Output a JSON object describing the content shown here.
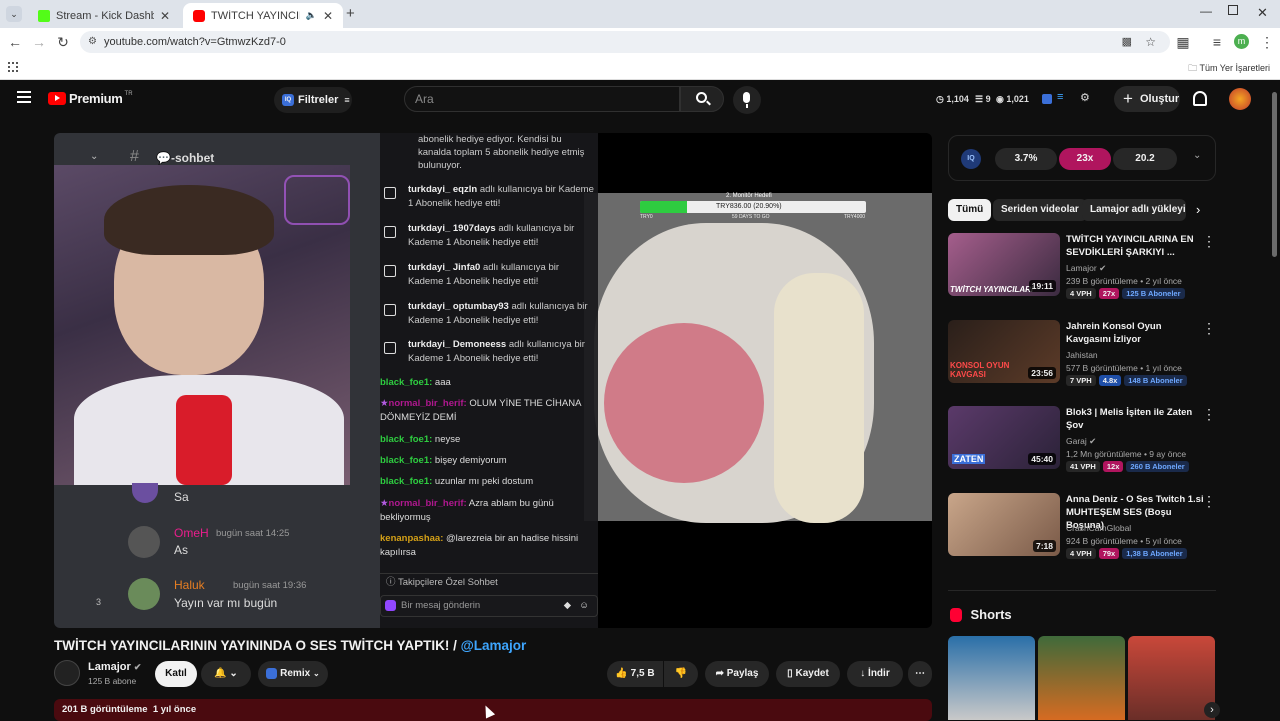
{
  "browser": {
    "tabs": [
      {
        "title": "Stream - Kick Dashboard",
        "active": false,
        "fav_color": "#53fc18"
      },
      {
        "title": "TWİTCH YAYINCILARININ YAYINI...",
        "active": true,
        "fav_color": "#ff0000"
      }
    ],
    "new_tab": "+",
    "url": "youtube.com/watch?v=GtmwzKzd7-0",
    "bookmarks_label": "Tüm Yer İşaretleri",
    "profile_initial": "m"
  },
  "youtube": {
    "logo": "Premium",
    "logo_sup": "TR",
    "filters_label": "Filtreler",
    "search_placeholder": "Ara",
    "stats": [
      "1,104",
      "9",
      "1,021"
    ],
    "create_label": "Oluştur"
  },
  "video": {
    "discord": {
      "channel": "-sohbet",
      "msg1_text": "Sa",
      "msg2_user": "OmeH",
      "msg2_time": "bugün saat 14:25",
      "msg2_text": "As",
      "msg3_user": "Haluk",
      "msg3_time": "bugün saat 19:36",
      "msg3_text": "Yayın var mı bugün",
      "side_number": "3"
    },
    "chat": {
      "intro": "abonelik hediye ediyor. Kendisi bu kanalda toplam 5 abonelik hediye etmiş bulunuyor.",
      "subs": [
        {
          "user": "turkdayi_ eqzln",
          "text": "adlı kullanıcıya bir Kademe 1 Abonelik hediye etti!"
        },
        {
          "user": "turkdayi_ 1907days",
          "text": "adlı kullanıcıya bir Kademe 1 Abonelik hediye etti!"
        },
        {
          "user": "turkdayi_ Jinfa0",
          "text": "adlı kullanıcıya bir Kademe 1 Abonelik hediye etti!"
        },
        {
          "user": "turkdayi_ optumbay93",
          "text": "adlı kullanıcıya bir Kademe 1 Abonelik hediye etti!"
        },
        {
          "user": "turkdayi_ Demoneess",
          "text": "adlı kullanıcıya bir Kademe 1 Abonelik hediye etti!"
        }
      ],
      "lines": [
        {
          "user": "black_foe1:",
          "text": "aaa",
          "color": "#2ecc40"
        },
        {
          "user": "normal_bir_herif:",
          "text": "OLUM YİNE THE CİHANA DÖNMEYİZ DEMİ",
          "color": "#b0188f"
        },
        {
          "user": "black_foe1:",
          "text": "neyse",
          "color": "#2ecc40"
        },
        {
          "user": "black_foe1:",
          "text": "bişey demiyorum",
          "color": "#2ecc40"
        },
        {
          "user": "black_foe1:",
          "text": "uzunlar mı peki dostum",
          "color": "#2ecc40"
        },
        {
          "user": "normal_bir_herif:",
          "text": "Azra ablam bu günü bekliyormuş",
          "color": "#b0188f"
        },
        {
          "user": "kenanpashaa:",
          "text": "@larezreia bir an hadise hissini kapılırsa",
          "color": "#d4a017"
        }
      ],
      "followers_only": "Takipçilere Özel Sohbet",
      "send_placeholder": "Bir mesaj gönderin"
    },
    "goal": {
      "title": "2. Monitör Hedefi",
      "amount": "TRY836.00 (20.90%)",
      "progress": 0.209,
      "left": "TRY0",
      "days": "59 DAYS TO GO",
      "right": "TRY4000"
    }
  },
  "iq": {
    "values": [
      "3.7%",
      "23x",
      "20.2"
    ]
  },
  "chips": [
    "Tümü",
    "Seriden videolar",
    "Lamajor adlı yükleyic"
  ],
  "recommendations": [
    {
      "title": "TWİTCH YAYINCILARINA EN SEVDİKLERİ ŞARKIYI ...",
      "channel": "Lamajor",
      "verified": true,
      "meta": "239 B görüntüleme • 2 yıl önce",
      "vph": "4 VPH",
      "mult": "27x",
      "subs": "125 B Aboneler",
      "duration": "19:11",
      "thumb_text": "TWİTCH YAYINCILARI"
    },
    {
      "title": "Jahrein Konsol Oyun Kavgasını İzliyor",
      "channel": "Jahistan",
      "verified": false,
      "meta": "577 B görüntüleme • 1 yıl önce",
      "vph": "7 VPH",
      "mult": "4.8x",
      "subs": "148 B Aboneler",
      "duration": "23:56",
      "thumb_text": "KONSOL OYUN KAVGASI"
    },
    {
      "title": "Blok3 | Melis İşiten ile Zaten Şov",
      "channel": "Garaj",
      "verified": true,
      "meta": "1,2 Mn görüntüleme • 9 ay önce",
      "vph": "41 VPH",
      "mult": "12x",
      "subs": "260 B Aboneler",
      "duration": "45:40",
      "thumb_text": "ZATEN"
    },
    {
      "title": "Anna Deniz - O Ses Twitch 1.si MUHTEŞEM SES (Boşu Boşuna)",
      "channel": "CrashCamGlobal",
      "verified": false,
      "meta": "924 B görüntüleme • 5 yıl önce",
      "vph": "4 VPH",
      "mult": "79x",
      "subs": "1,38 B Aboneler",
      "duration": "7:18",
      "thumb_text": ""
    }
  ],
  "shorts_label": "Shorts",
  "main": {
    "title": "TWİTCH YAYINCILARININ YAYININDA O SES TWİTCH YAPTIK! / ",
    "title_mention": "@Lamajor",
    "channel": "Lamajor",
    "subs": "125 B abone",
    "join": "Katıl",
    "remix": "Remix",
    "likes": "7,5 B",
    "share": "Paylaş",
    "save": "Kaydet",
    "download": "İndir",
    "desc_views": "201 B görüntüleme",
    "desc_time": "1 yıl önce"
  }
}
